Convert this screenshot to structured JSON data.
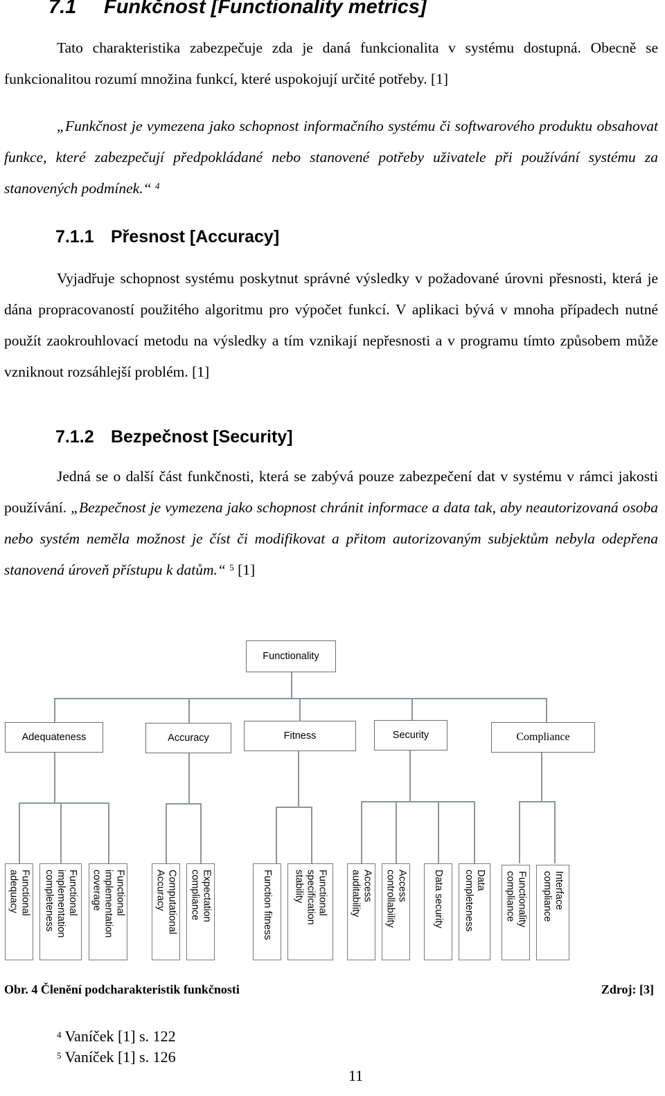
{
  "section": {
    "number": "7.1",
    "title": "Funkčnost [Functionality metrics]",
    "intro": "Tato charakteristika zabezpečuje zda je daná funkcionalita v systému dostupná. Obecně se funkcionalitou rozumí množina funkcí, které uspokojují určité potřeby. [1]",
    "quote": "„Funkčnost je vymezena jako schopnost informačního systému či softwarového produktu obsahovat funkce, které zabezpečují předpokládané nebo stanovené potřeby uživatele při používání systému za stanovených podmínek.“",
    "quote_footnote_ref": "4"
  },
  "subsections": [
    {
      "number": "7.1.1",
      "title": "Přesnost [Accuracy]",
      "text": "Vyjadřuje  schopnost systému poskytnut správné výsledky v požadované úrovni přesnosti, která je dána propracovaností použitého algoritmu pro výpočet funkcí. V aplikaci bývá v mnoha případech nutné použít zaokrouhlovací metodu na výsledky a tím vznikají nepřesnosti a v programu tímto způsobem může vzniknout rozsáhlejší problém. [1]"
    },
    {
      "number": "7.1.2",
      "title": "Bezpečnost [Security]",
      "text_plain": "Jedná se o další část funkčnosti, která se zabývá pouze zabezpečení dat v systému v rámci jakosti používání. ",
      "text_quote": "„Bezpečnost je vymezena jako schopnost chránit informace a data tak, aby neautorizovaná osoba nebo systém neměla možnost je číst či modifikovat a přitom autorizovaným subjektům nebyla odepřena stanovená úroveň přístupu k datům.“",
      "quote_footnote_ref": "5",
      "text_after": "[1]"
    }
  ],
  "diagram": {
    "root": "Functionality",
    "children": [
      {
        "label": "Adequateness",
        "leaves": [
          "Functional\nadequacy",
          "Functional\nimplementation\ncompleteness",
          "Functional\nimplementation\ncoverage"
        ]
      },
      {
        "label": "Accuracy",
        "leaves": [
          "Computational\nAccuracy",
          "Expectation\ncompliance"
        ]
      },
      {
        "label": "Fitness",
        "leaves": [
          "Function fitness",
          "Functional\nspecification\nstability"
        ]
      },
      {
        "label": "Security",
        "leaves": [
          "Access\nauditability",
          "Access\ncontrollability",
          "Data security",
          "Data\ncompleteness"
        ]
      },
      {
        "label": "Compliance",
        "leaves": [
          "Functionality\ncompliance",
          "Interface\ncompliance"
        ]
      }
    ]
  },
  "caption": {
    "left": "Obr. 4 Členění podcharakteristik funkčnosti",
    "right": "Zdroj: [3]"
  },
  "footnotes": [
    {
      "num": "4",
      "text": "Vaníček [1] s. 122"
    },
    {
      "num": "5",
      "text": "Vaníček [1] s. 126"
    }
  ],
  "page_number": "11"
}
